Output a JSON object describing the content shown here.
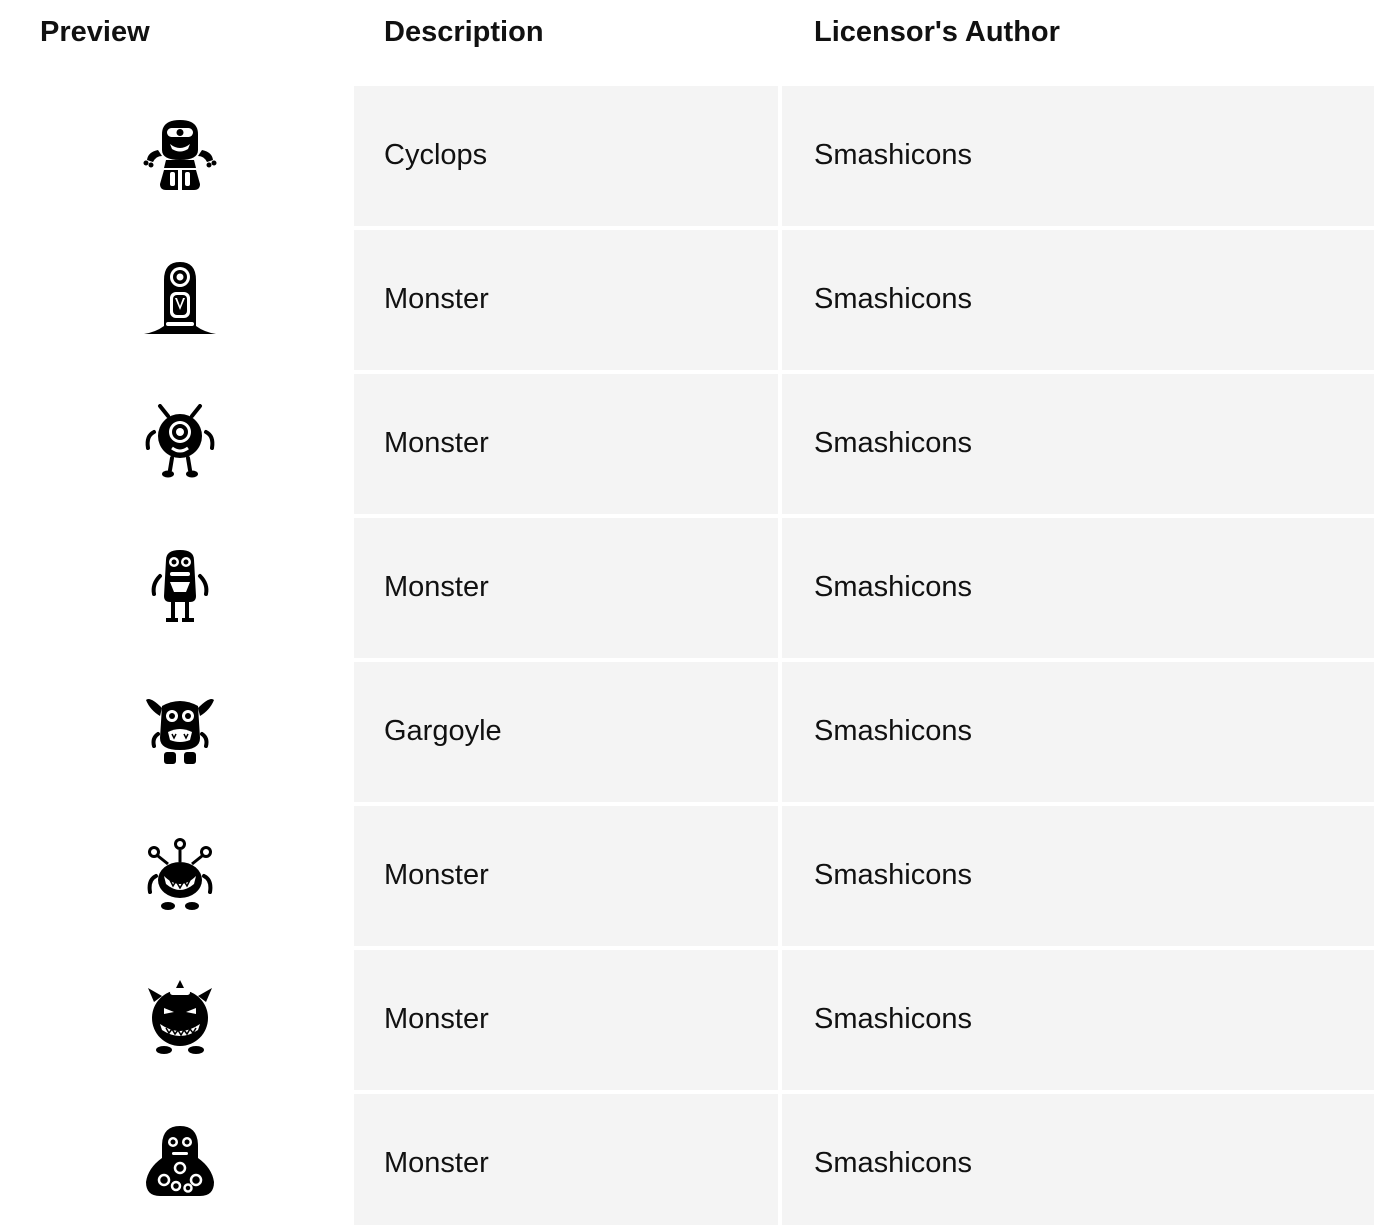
{
  "table": {
    "headers": {
      "preview": "Preview",
      "description": "Description",
      "author": "Licensor's Author"
    },
    "rows": [
      {
        "icon": "cyclops-icon",
        "description": "Cyclops",
        "author": "Smashicons"
      },
      {
        "icon": "monster-icon",
        "description": "Monster",
        "author": "Smashicons"
      },
      {
        "icon": "monster-icon",
        "description": "Monster",
        "author": "Smashicons"
      },
      {
        "icon": "monster-icon",
        "description": "Monster",
        "author": "Smashicons"
      },
      {
        "icon": "gargoyle-icon",
        "description": "Gargoyle",
        "author": "Smashicons"
      },
      {
        "icon": "monster-icon",
        "description": "Monster",
        "author": "Smashicons"
      },
      {
        "icon": "monster-icon",
        "description": "Monster",
        "author": "Smashicons"
      },
      {
        "icon": "monster-icon",
        "description": "Monster",
        "author": "Smashicons"
      }
    ]
  },
  "colors": {
    "cell_background": "#f4f4f4",
    "text": "#111111",
    "icon": "#000000"
  }
}
